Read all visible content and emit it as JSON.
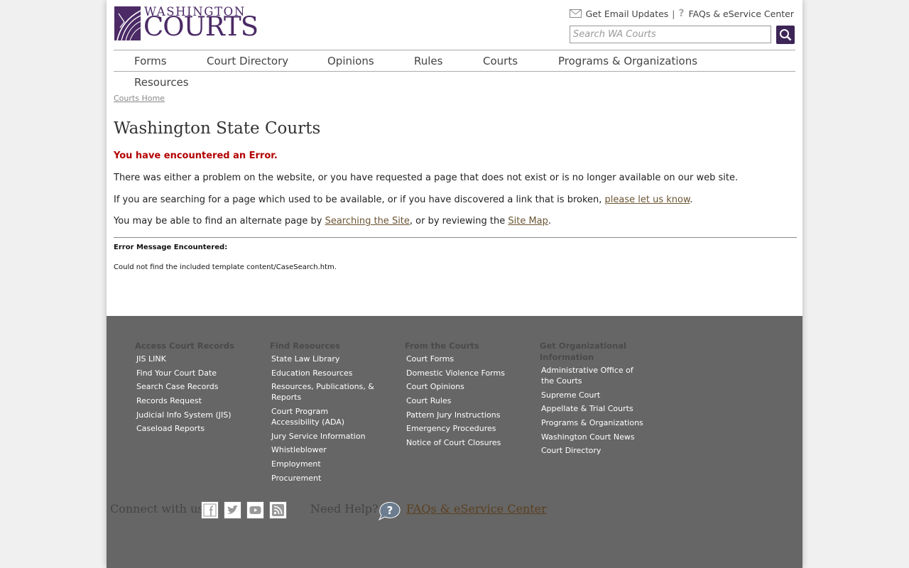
{
  "logo": {
    "line1": "WASHINGTON",
    "line2": "COURTS"
  },
  "header": {
    "email_updates": "Get Email Updates",
    "separator": "|",
    "faqs": "FAQs & eService Center",
    "search_placeholder": "Search WA Courts"
  },
  "nav": [
    "Forms",
    "Court Directory",
    "Opinions",
    "Rules",
    "Courts",
    "Programs & Organizations",
    "Resources"
  ],
  "breadcrumb": "Courts Home",
  "main": {
    "title": "Washington State Courts",
    "error_heading": "You have encountered an Error.",
    "p1": "There was either a problem on the website, or you have requested a page that does not exist or is no longer available on our web site.",
    "p2_prefix": "If you are searching for a page which used to be available, or if you have discovered a link that is broken, ",
    "p2_link": "please let us know",
    "p2_suffix": ".",
    "p3_prefix": "You may be able to find an alternate page by ",
    "p3_link1": "Searching the Site",
    "p3_mid": ", or by reviewing the ",
    "p3_link2": "Site Map",
    "p3_suffix": ".",
    "error_label": "Error Message Encountered:",
    "error_detail": "Could not find the included template content/CaseSearch.htm."
  },
  "footer": {
    "columns": [
      {
        "heading": "Access Court Records",
        "links": [
          "JIS LINK",
          "Find Your Court Date",
          "Search Case Records",
          "Records Request",
          "Judicial Info System (JIS)",
          "Caseload Reports"
        ]
      },
      {
        "heading": "Find Resources",
        "links": [
          "State Law Library",
          "Education Resources",
          "Resources, Publications, & Reports",
          "Court Program Accessibility (ADA)",
          "Jury Service Information",
          "Whistleblower",
          "Employment",
          "Procurement"
        ]
      },
      {
        "heading": "From the Courts",
        "links": [
          "Court Forms",
          "Domestic Violence Forms",
          "Court Opinions",
          "Court Rules",
          "Pattern Jury Instructions",
          "Emergency Procedures",
          "Notice of Court Closures"
        ]
      },
      {
        "heading": "Get Organizational Information",
        "links": [
          "Administrative Office of the Courts",
          "Supreme Court",
          "Appellate & Trial Courts",
          "Programs & Organizations",
          "Washington Court News",
          "Court Directory"
        ]
      }
    ],
    "connect": "Connect with us",
    "need_help": "Need Help?",
    "faqs_link": "FAQs & eService Center"
  },
  "colors": {
    "brand": "#4b2a66",
    "error": "#b30000",
    "footer_bg": "#666666"
  }
}
